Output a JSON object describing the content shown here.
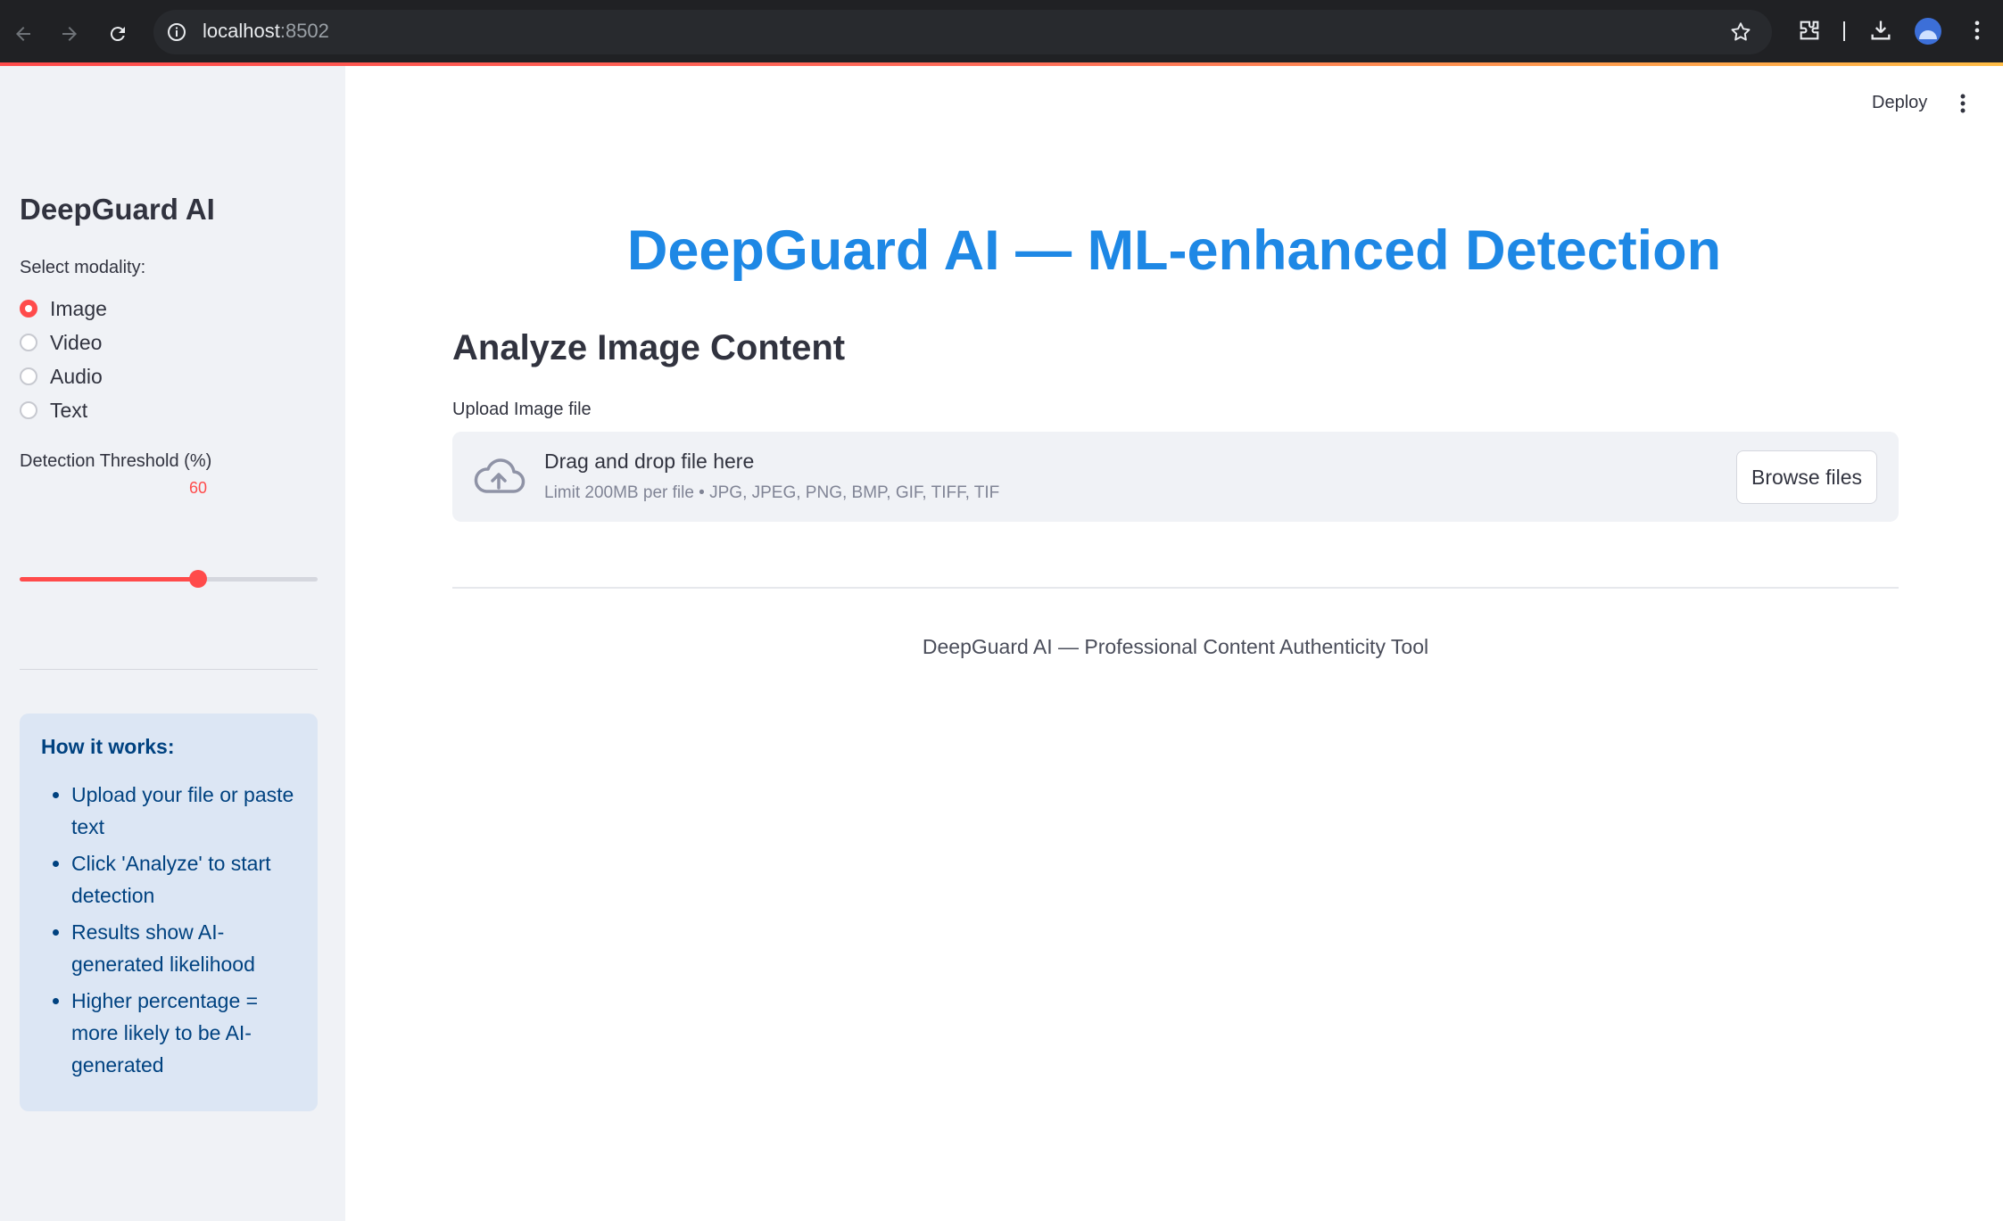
{
  "browser": {
    "url_host": "localhost",
    "url_port": ":8502"
  },
  "sidebar": {
    "title": "DeepGuard AI",
    "modality_label": "Select modality:",
    "modalities": [
      {
        "label": "Image",
        "selected": true
      },
      {
        "label": "Video",
        "selected": false
      },
      {
        "label": "Audio",
        "selected": false
      },
      {
        "label": "Text",
        "selected": false
      }
    ],
    "threshold_label": "Detection Threshold (%)",
    "threshold_value": "60",
    "threshold_fraction": 0.6,
    "info": {
      "title": "How it works:",
      "items": [
        "Upload your file or paste text",
        "Click 'Analyze' to start detection",
        "Results show AI-generated likelihood",
        "Higher percentage = more likely to be AI-generated"
      ]
    }
  },
  "header": {
    "deploy_label": "Deploy"
  },
  "main": {
    "title": "DeepGuard AI — ML-enhanced Detection",
    "section_heading": "Analyze Image Content",
    "upload_label": "Upload Image file",
    "dropzone_title": "Drag and drop file here",
    "dropzone_sub": "Limit 200MB per file • JPG, JPEG, PNG, BMP, GIF, TIFF, TIF",
    "browse_label": "Browse files",
    "footer": "DeepGuard AI — Professional Content Authenticity Tool"
  },
  "colors": {
    "accent": "#ff4b4b",
    "title_blue": "#1e88e5",
    "info_text": "#004280",
    "info_bg": "#dce6f4"
  }
}
